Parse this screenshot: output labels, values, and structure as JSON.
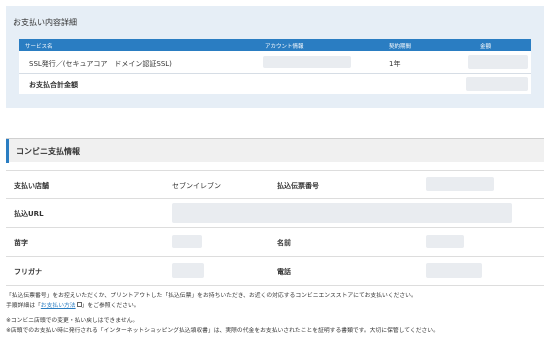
{
  "payment_details": {
    "title": "お支払い内容詳細",
    "columns": {
      "service": "サービス名",
      "account": "アカウント情報",
      "term": "契約期間",
      "amount": "金額"
    },
    "row": {
      "service": "SSL発行／(セキュアコア　ドメイン認証SSL)",
      "term": "1年"
    },
    "total_label": "お支払合計金額"
  },
  "convenience": {
    "title": "コンビニ支払情報",
    "rows": {
      "store_label": "支払い店舗",
      "store_value": "セブンイレブン",
      "slip_label": "払込伝票番号",
      "url_label": "払込URL",
      "last_name_label": "苗字",
      "first_name_label": "名前",
      "furigana_label": "フリガナ",
      "phone_label": "電話"
    }
  },
  "notes": {
    "line1": "「払込伝票番号」をお控えいただくか、プリントアウトした「払込伝票」をお持ちいただき、お近くの対応するコンビニエンスストアにてお支払いください。",
    "line2_prefix": "手順詳細は「",
    "line2_link": "お支払い方法",
    "line2_suffix": "」をご参照ください。",
    "line3": "※コンビニ店頭での変更・払い戻しはできません。",
    "line4": "※店頭でのお支払い時に発行される「インターネットショッピング払込領収書」は、実際の代金をお支払いされたことを証明する書類です。大切に保管してください。"
  }
}
